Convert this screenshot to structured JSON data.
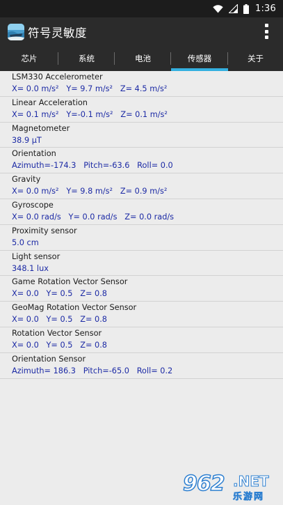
{
  "status_bar": {
    "time": "1:36",
    "icons": [
      "wifi-icon",
      "signal-icon",
      "battery-icon"
    ]
  },
  "app": {
    "title": "符号灵敏度",
    "icon": "app-icon",
    "menu_icon": "overflow-menu-icon"
  },
  "tabs": [
    {
      "label": "芯片",
      "selected": false
    },
    {
      "label": "系统",
      "selected": false
    },
    {
      "label": "电池",
      "selected": false
    },
    {
      "label": "传感器",
      "selected": true
    },
    {
      "label": "关于",
      "selected": false
    }
  ],
  "sensors": [
    {
      "name": "LSM330 Accelerometer",
      "value": "X= 0.0 m/s²   Y= 9.7 m/s²   Z= 4.5 m/s²"
    },
    {
      "name": "Linear Acceleration",
      "value": "X= 0.1 m/s²   Y=-0.1 m/s²   Z= 0.1 m/s²"
    },
    {
      "name": "Magnetometer",
      "value": "38.9 μT"
    },
    {
      "name": "Orientation",
      "value": "Azimuth=-174.3   Pitch=-63.6   Roll= 0.0"
    },
    {
      "name": "Gravity",
      "value": "X= 0.0 m/s²   Y= 9.8 m/s²   Z= 0.9 m/s²"
    },
    {
      "name": "Gyroscope",
      "value": "X= 0.0 rad/s   Y= 0.0 rad/s   Z= 0.0 rad/s"
    },
    {
      "name": "Proximity sensor",
      "value": "5.0 cm"
    },
    {
      "name": "Light sensor",
      "value": "348.1 lux"
    },
    {
      "name": "Game Rotation Vector Sensor",
      "value": "X= 0.0   Y= 0.5   Z= 0.8"
    },
    {
      "name": "GeoMag Rotation Vector Sensor",
      "value": "X= 0.0   Y= 0.5   Z= 0.8"
    },
    {
      "name": "Rotation Vector Sensor",
      "value": "X= 0.0   Y= 0.5   Z= 0.8"
    },
    {
      "name": "Orientation Sensor",
      "value": "Azimuth= 186.3   Pitch=-65.0   Roll= 0.2"
    }
  ],
  "watermark": {
    "number": "962",
    "suffix": ".NET",
    "chinese": "乐游网"
  },
  "colors": {
    "accent": "#34b0e0",
    "value_text": "#1c2aa5",
    "app_bar": "#2b2b2b"
  }
}
